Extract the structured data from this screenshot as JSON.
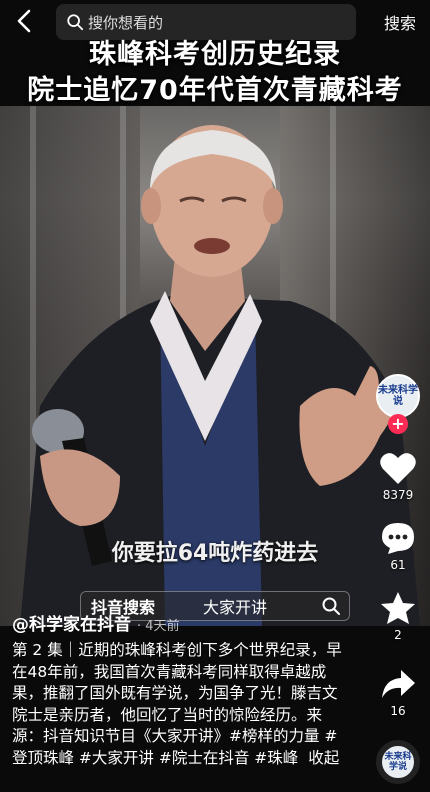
{
  "header": {
    "search_placeholder": "搜你想看的",
    "search_button": "搜索"
  },
  "video": {
    "title_line1": "珠峰科考创历史纪录",
    "title_line2": "院士追忆70年代首次青藏科考",
    "subtitle": "你要拉64吨炸药进去"
  },
  "creator": {
    "avatar_text": "未来科学说",
    "handle": "@科学家在抖音",
    "posted": "· 4天前"
  },
  "actions": {
    "likes": "8379",
    "comments": "61",
    "favorites": "2",
    "shares": "16"
  },
  "tags_bar": {
    "label": "抖音搜索",
    "query": "大家开讲"
  },
  "description": {
    "text": "第 2 集｜近期的珠峰科考创下多个世界纪录，早在48年前，我国首次青藏科考同样取得卓越成果，推翻了国外既有学说，为国争了光！滕吉文院士是亲历者，他回忆了当时的惊险经历。来源：抖音知识节目《大家开讲》#榜样的力量 #登顶珠峰 #大家开讲 #院士在抖音 #珠峰",
    "collapse_label": "收起"
  },
  "colors": {
    "follow": "#fe2c55",
    "text": "#ffffff"
  }
}
